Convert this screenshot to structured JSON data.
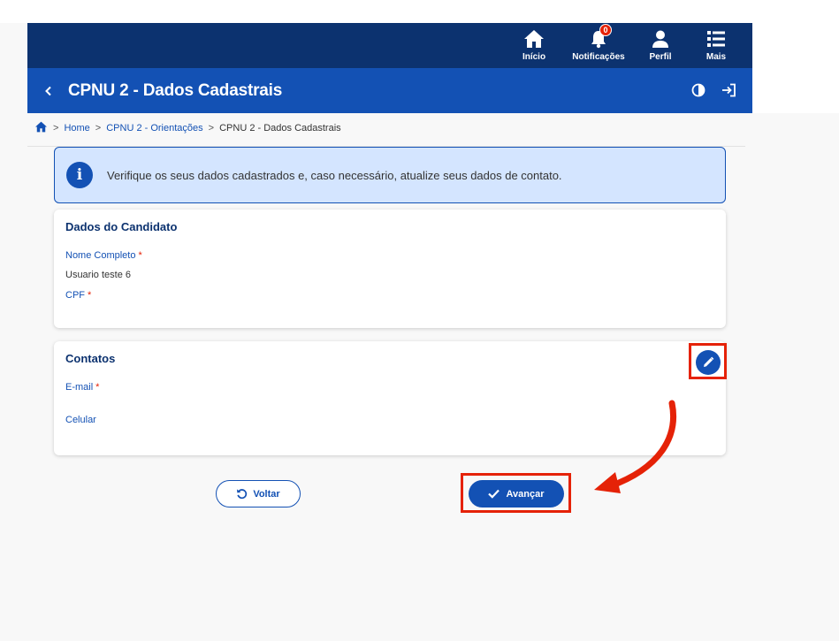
{
  "header": {
    "nav": [
      {
        "label": "Início",
        "icon": "home-icon"
      },
      {
        "label": "Notificações",
        "icon": "bell-icon",
        "badge": "0"
      },
      {
        "label": "Perfil",
        "icon": "user-icon"
      },
      {
        "label": "Mais",
        "icon": "list-icon"
      }
    ],
    "title": "CPNU 2 - Dados Cadastrais"
  },
  "breadcrumb": {
    "home_icon": "home-icon",
    "items": [
      "Home",
      "CPNU 2 - Orientações",
      "CPNU 2 - Dados Cadastrais"
    ]
  },
  "alert": {
    "icon": "info-icon",
    "message": "Verifique os seus dados cadastrados e, caso necessário, atualize seus dados de contato."
  },
  "candidate": {
    "title": "Dados do Candidato",
    "name_label": "Nome Completo",
    "name_value": "Usuario teste 6",
    "cpf_label": "CPF",
    "required_mark": "*"
  },
  "contacts": {
    "title": "Contatos",
    "email_label": "E-mail",
    "phone_label": "Celular",
    "required_mark": "*"
  },
  "actions": {
    "back_label": "Voltar",
    "next_label": "Avançar"
  },
  "colors": {
    "header_dark": "#0c326f",
    "header_primary": "#1351b4",
    "alert_bg": "#d4e5ff",
    "highlight_red": "#e52207"
  }
}
